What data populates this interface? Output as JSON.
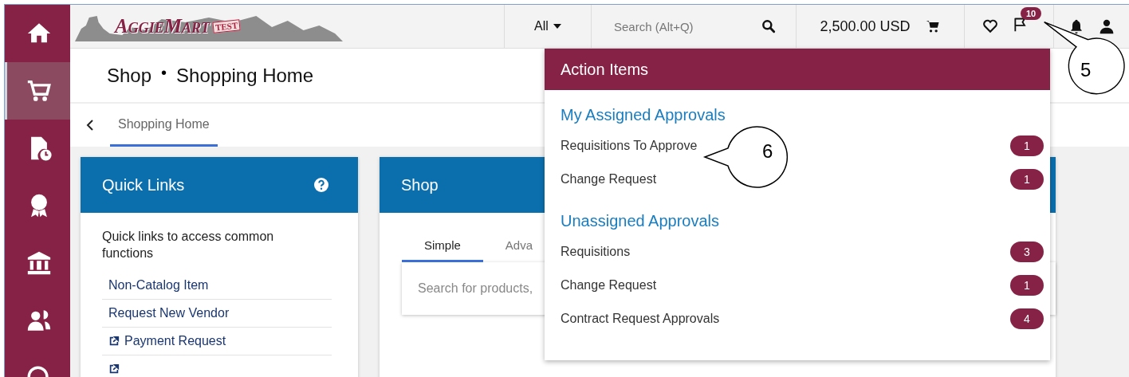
{
  "sidebar": {
    "items": [
      {
        "kind": "home",
        "selected": false
      },
      {
        "kind": "cart",
        "selected": true
      },
      {
        "kind": "document-clock",
        "selected": false
      },
      {
        "kind": "award",
        "selected": false
      },
      {
        "kind": "bank",
        "selected": false
      },
      {
        "kind": "users",
        "selected": false
      },
      {
        "kind": "globe-search",
        "selected": false
      }
    ]
  },
  "topbar": {
    "logo": "AggieMart",
    "logo_stamp": "TEST",
    "scope": "All",
    "search": {
      "placeholder": "Search (Alt+Q)"
    },
    "cart_total": "2,500.00 USD",
    "action_badge": "10"
  },
  "page_header": {
    "section": "Shop",
    "separator": "•",
    "title": "Shopping Home"
  },
  "breadcrumb": {
    "tabs": [
      {
        "label": "Shopping Home",
        "selected": true
      }
    ]
  },
  "quick_links": {
    "title": "Quick Links",
    "description": "Quick links to access common functions",
    "links": [
      {
        "label": "Non-Catalog Item",
        "external": false
      },
      {
        "label": "Request New Vendor",
        "external": false
      },
      {
        "label": "Payment Request",
        "external": true
      },
      {
        "external": true
      }
    ]
  },
  "shop": {
    "title": "Shop",
    "tabs": [
      {
        "label": "Simple",
        "selected": true
      },
      {
        "label": "Adva",
        "selected": false
      }
    ],
    "search": {
      "placeholder": "Search for products,"
    }
  },
  "action_items": {
    "title": "Action Items",
    "sections": [
      {
        "title": "My Assigned Approvals",
        "items": [
          {
            "label": "Requisitions To Approve",
            "count": "1"
          },
          {
            "label": "Change Request",
            "count": "1"
          }
        ]
      },
      {
        "title": "Unassigned Approvals",
        "items": [
          {
            "label": "Requisitions",
            "count": "3"
          },
          {
            "label": "Change Request",
            "count": "1"
          },
          {
            "label": "Contract Request Approvals",
            "count": "4"
          }
        ]
      }
    ]
  },
  "callouts": [
    {
      "label": "5"
    },
    {
      "label": "6"
    }
  ]
}
